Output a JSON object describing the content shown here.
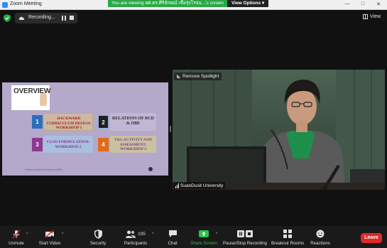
{
  "window": {
    "title": "Zoom Meeting",
    "viewing_banner": "You are viewing ผศ.ดร.ศิริลักษณ์ เชื้อรุ่งโรจน...'s screen",
    "view_options": "View Options"
  },
  "top_controls": {
    "recording_label": "Recording...",
    "view_label": "View"
  },
  "shared_slide": {
    "overview_title": "OVERVIEW",
    "cards": [
      {
        "number": "1",
        "text": "BACKWARD CURRICULUM DESIGN: WORKSHOP 1"
      },
      {
        "number": "2",
        "text": "RELATIONS OF RCD & OBE"
      },
      {
        "number": "3",
        "text": "CLOS FORMULATION: WORKSHOP 2"
      },
      {
        "number": "4",
        "text": "T&L ACTIVITY AND ASSESSMENT: WORKSHOP 3"
      }
    ],
    "footer": "Outcome-Based Education (OBE)"
  },
  "video": {
    "spotlight_label": "Remove Spotlight",
    "participant_name": "SuanDusit University"
  },
  "toolbar": {
    "unmute": "Unmute",
    "start_video": "Start Video",
    "security": "Security",
    "participants": "Participants",
    "participants_count": "235",
    "chat": "Chat",
    "share_screen": "Share Screen",
    "pause_recording": "Pause/Stop Recording",
    "breakout_rooms": "Breakout Rooms",
    "reactions": "Reactions",
    "leave": "Leave"
  },
  "colors": {
    "share_green": "#2fbf4b",
    "leave_red": "#e02828",
    "slide_bg": "#b4a8cb",
    "card1_num": "#2c6fb7",
    "card2_num": "#1f1f1f",
    "card3_num": "#8b3a8f",
    "card4_num": "#e06a1a"
  }
}
